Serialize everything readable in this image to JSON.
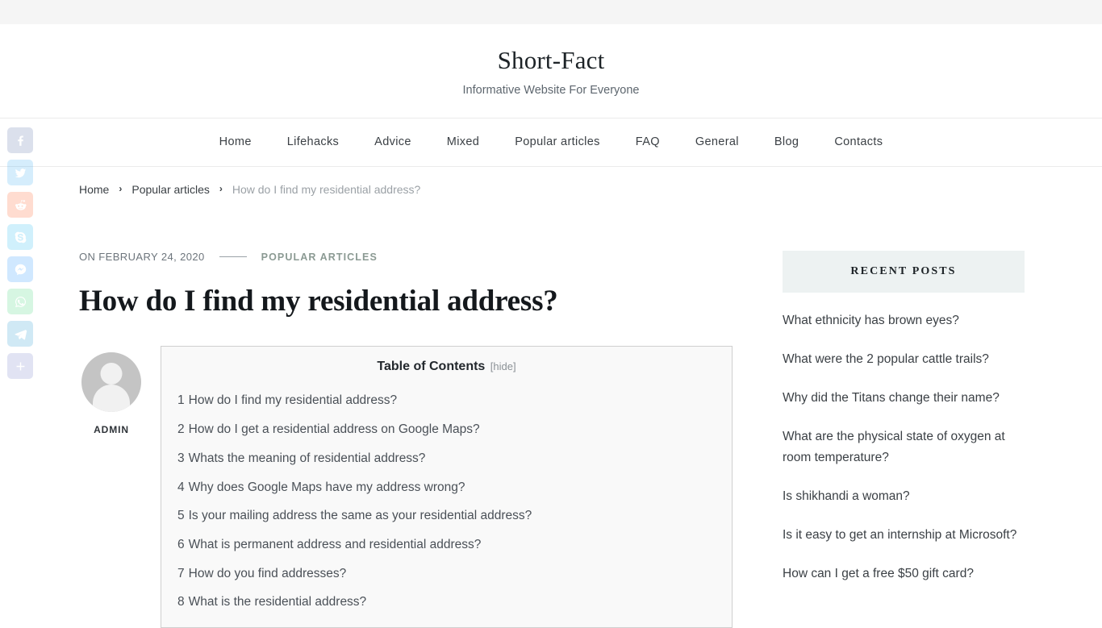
{
  "header": {
    "site_title": "Short-Fact",
    "tagline": "Informative Website For Everyone"
  },
  "nav": {
    "items": [
      {
        "label": "Home"
      },
      {
        "label": "Lifehacks"
      },
      {
        "label": "Advice"
      },
      {
        "label": "Mixed"
      },
      {
        "label": "Popular articles"
      },
      {
        "label": "FAQ"
      },
      {
        "label": "General"
      },
      {
        "label": "Blog"
      },
      {
        "label": "Contacts"
      }
    ]
  },
  "breadcrumb": {
    "items": [
      {
        "label": "Home",
        "current": false
      },
      {
        "label": "Popular articles",
        "current": false
      },
      {
        "label": "How do I find my residential address?",
        "current": true
      }
    ],
    "separator": "›"
  },
  "post": {
    "meta_date": "ON FEBRUARY 24, 2020",
    "category": "POPULAR ARTICLES",
    "title": "How do I find my residential address?",
    "author": "ADMIN"
  },
  "toc": {
    "heading": "Table of Contents",
    "toggle": "[hide]",
    "items": [
      {
        "num": "1",
        "label": "How do I find my residential address?"
      },
      {
        "num": "2",
        "label": "How do I get a residential address on Google Maps?"
      },
      {
        "num": "3",
        "label": "Whats the meaning of residential address?"
      },
      {
        "num": "4",
        "label": "Why does Google Maps have my address wrong?"
      },
      {
        "num": "5",
        "label": "Is your mailing address the same as your residential address?"
      },
      {
        "num": "6",
        "label": "What is permanent address and residential address?"
      },
      {
        "num": "7",
        "label": "How do you find addresses?"
      },
      {
        "num": "8",
        "label": "What is the residential address?"
      }
    ]
  },
  "sidebar": {
    "widget_title": "RECENT POSTS",
    "posts": [
      {
        "label": "What ethnicity has brown eyes?"
      },
      {
        "label": "What were the 2 popular cattle trails?"
      },
      {
        "label": "Why did the Titans change their name?"
      },
      {
        "label": "What are the physical state of oxygen at room temperature?"
      },
      {
        "label": "Is shikhandi a woman?"
      },
      {
        "label": "Is it easy to get an internship at Microsoft?"
      },
      {
        "label": "How can I get a free $50 gift card?"
      }
    ]
  },
  "social": {
    "buttons": [
      {
        "name": "facebook",
        "color": "#3b5998"
      },
      {
        "name": "twitter",
        "color": "#1da1f2"
      },
      {
        "name": "reddit",
        "color": "#ff4500"
      },
      {
        "name": "skype",
        "color": "#00aff0"
      },
      {
        "name": "messenger",
        "color": "#0084ff"
      },
      {
        "name": "whatsapp",
        "color": "#25d366"
      },
      {
        "name": "telegram",
        "color": "#0088cc"
      },
      {
        "name": "share",
        "color": "#5c6bc0"
      }
    ]
  },
  "colors": {
    "topbar": "#f5f5f5",
    "category": "#8b9a93",
    "widget_box": "#edf2f2",
    "toc_bg": "#f9f9f9",
    "toc_border": "#cfcfcf"
  }
}
